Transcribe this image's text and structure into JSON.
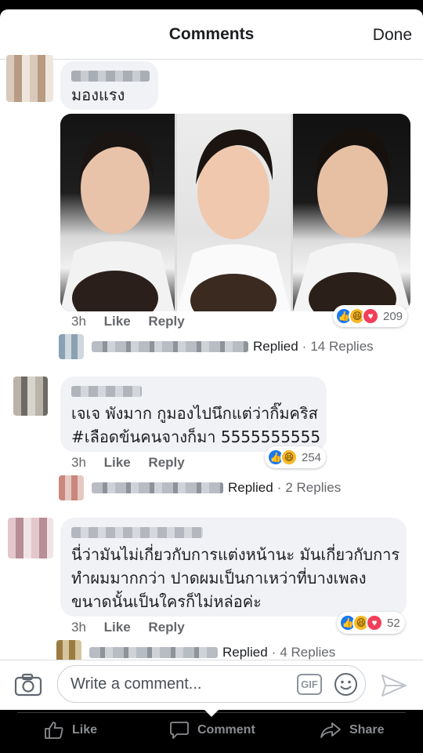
{
  "header": {
    "title": "Comments",
    "done_label": "Done"
  },
  "comments": [
    {
      "text_lines": [
        "มองแรง"
      ],
      "time": "3h",
      "like_label": "Like",
      "reply_label": "Reply",
      "reactions": {
        "count": "209",
        "types": [
          "like",
          "haha",
          "love"
        ]
      },
      "replied": {
        "label": "Replied",
        "count": "14 Replies"
      }
    },
    {
      "text_lines": [
        "เจเจ พังมาก กูมองไปนึกแต่ว่ากิ๊มคริส",
        "#เลือดข้นคนจางก็มา 5555555555"
      ],
      "time": "3h",
      "like_label": "Like",
      "reply_label": "Reply",
      "reactions": {
        "count": "254",
        "types": [
          "like",
          "haha"
        ]
      },
      "replied": {
        "label": "Replied",
        "count": "2 Replies"
      }
    },
    {
      "text_lines": [
        "นี่ว่ามันไม่เกี่ยวกับการแต่งหน้านะ มันเกี่ยวกับการ",
        "ทำผมมากกว่า ปาดผมเป็นกาเหว่าที่บางเพลง",
        "ขนาดนั้นเป็นใครก็ไม่หล่อค่ะ"
      ],
      "time": "3h",
      "like_label": "Like",
      "reply_label": "Reply",
      "reactions": {
        "count": "52",
        "types": [
          "like",
          "haha",
          "love"
        ]
      },
      "replied": {
        "label": "Replied",
        "count": "4 Replies"
      }
    }
  ],
  "compose": {
    "placeholder": "Write a comment...",
    "gif_label": "GIF"
  },
  "bottom_bar": {
    "like": "Like",
    "comment": "Comment",
    "share": "Share"
  },
  "colors": {
    "accent": "#1877f2",
    "bubble": "#f0f2f5",
    "meta": "#65676b",
    "love": "#f33e58",
    "haha": "#f7b928"
  }
}
